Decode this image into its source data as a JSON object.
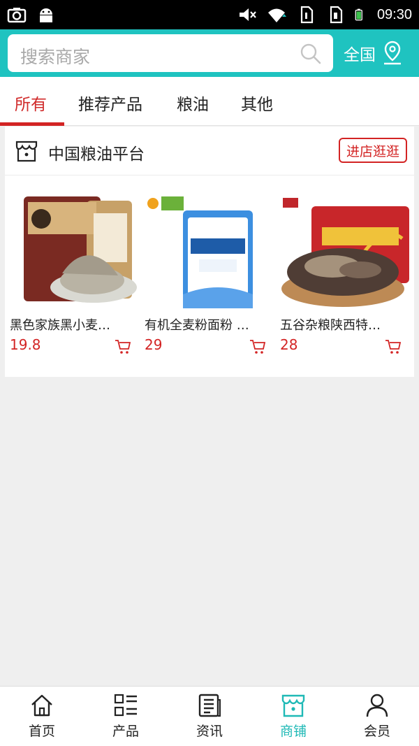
{
  "status_bar": {
    "time": "09:30"
  },
  "search": {
    "placeholder": "搜索商家",
    "region": "全国"
  },
  "tabs": [
    {
      "label": "所有",
      "active": true
    },
    {
      "label": "推荐产品",
      "active": false
    },
    {
      "label": "粮油",
      "active": false
    },
    {
      "label": "其他",
      "active": false
    }
  ],
  "shop": {
    "name": "中国粮油平台",
    "enter_label": "进店逛逛",
    "products": [
      {
        "title": "黑色家族黑小麦…",
        "price": "19.8"
      },
      {
        "title": "有机全麦粉面粉 …",
        "price": "29"
      },
      {
        "title": "五谷杂粮陕西特…",
        "price": "28"
      }
    ]
  },
  "bottom_nav": [
    {
      "label": "首页",
      "icon": "home-icon",
      "active": false
    },
    {
      "label": "产品",
      "icon": "list-icon",
      "active": false
    },
    {
      "label": "资讯",
      "icon": "news-icon",
      "active": false
    },
    {
      "label": "商铺",
      "icon": "store-icon",
      "active": true
    },
    {
      "label": "会员",
      "icon": "user-icon",
      "active": false
    }
  ],
  "colors": {
    "accent": "#1fc3c0",
    "brand_red": "#d32424",
    "nav_active": "#1fb9b6"
  }
}
